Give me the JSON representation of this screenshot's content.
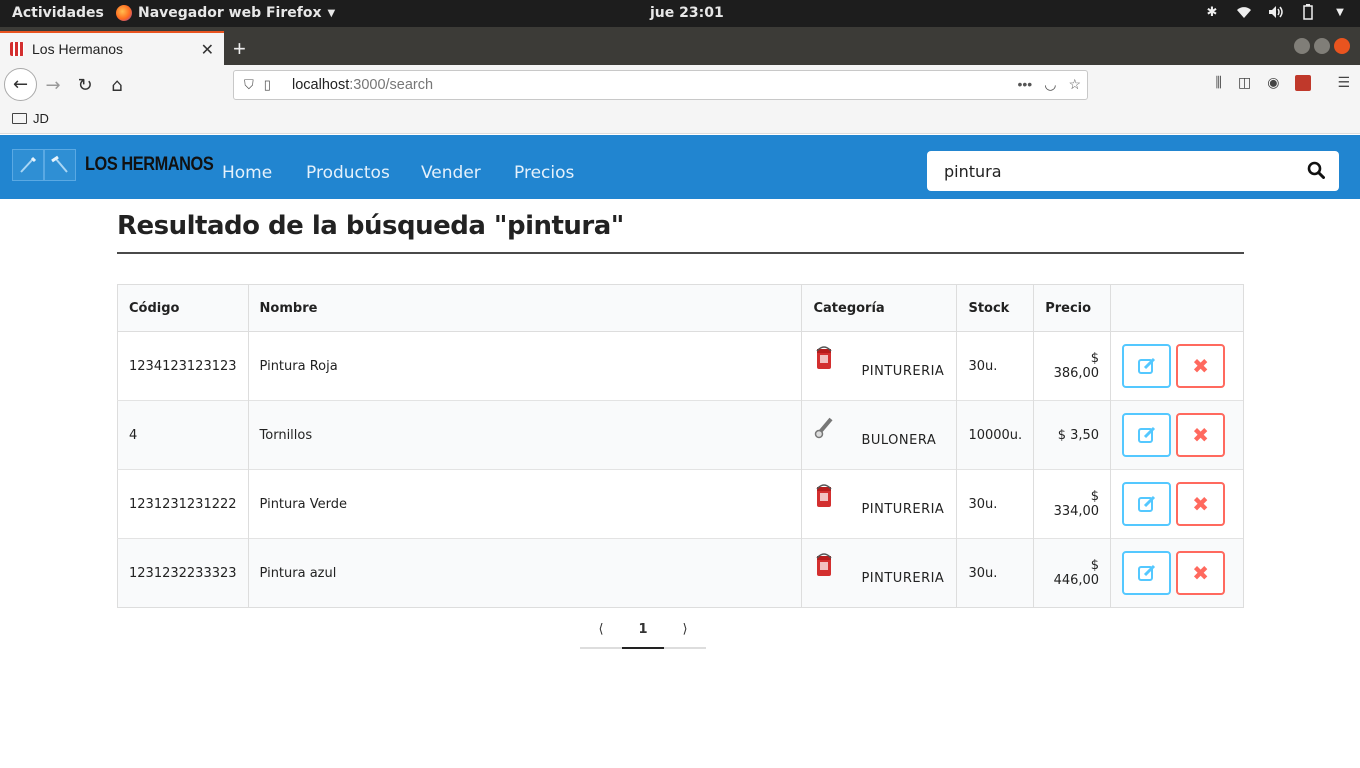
{
  "system_bar": {
    "activities": "Actividades",
    "app_name": "Navegador web Firefox",
    "clock": "jue 23:01"
  },
  "browser": {
    "tab_title": "Los Hermanos",
    "url_host": "localhost",
    "url_path": ":3000/search",
    "bookmark_folder": "JD"
  },
  "app": {
    "brand": "LOS HERMANOS",
    "menu": [
      "Home",
      "Productos",
      "Vender",
      "Precios"
    ],
    "search_value": "pintura",
    "colors": {
      "header": "#2185d0",
      "edit": "#54c8ff",
      "delete": "#ff695e"
    }
  },
  "results": {
    "heading": "Resultado de la búsqueda \"pintura\"",
    "columns": [
      "Código",
      "Nombre",
      "Categoría",
      "Stock",
      "Precio",
      ""
    ],
    "rows": [
      {
        "codigo": "1234123123123",
        "nombre": "Pintura Roja",
        "categoria": "PINTURERIA",
        "icon": "paint-can-icon",
        "stock": "30u.",
        "precio": "$ 386,00"
      },
      {
        "codigo": "4",
        "nombre": "Tornillos",
        "categoria": "BULONERA",
        "icon": "bolt-icon",
        "stock": "10000u.",
        "precio": "$ 3,50"
      },
      {
        "codigo": "1231231231222",
        "nombre": "Pintura Verde",
        "categoria": "PINTURERIA",
        "icon": "paint-can-icon",
        "stock": "30u.",
        "precio": "$ 334,00"
      },
      {
        "codigo": "1231232233323",
        "nombre": "Pintura azul",
        "categoria": "PINTURERIA",
        "icon": "paint-can-icon",
        "stock": "30u.",
        "precio": "$ 446,00"
      }
    ]
  },
  "pagination": {
    "prev": "⟨",
    "current": "1",
    "next": "⟩"
  }
}
